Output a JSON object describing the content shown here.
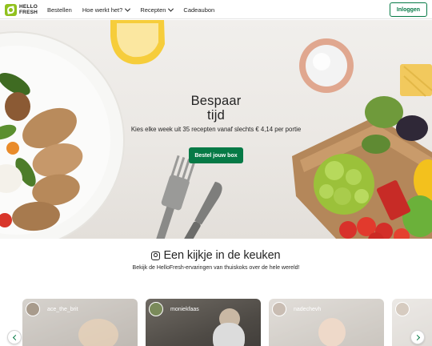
{
  "header": {
    "logo_text": "HELLO FRESH",
    "nav": [
      {
        "label": "Bestellen",
        "has_dropdown": false
      },
      {
        "label": "Hoe werkt het?",
        "has_dropdown": true
      },
      {
        "label": "Recepten",
        "has_dropdown": true
      },
      {
        "label": "Cadeaubon",
        "has_dropdown": false
      }
    ],
    "login_label": "Inloggen"
  },
  "hero": {
    "title_line1": "Bespaar",
    "title_line2": "tijd",
    "subtitle": "Kies elke week uit 35 recepten vanaf slechts € 4,14 per portie",
    "cta_label": "Bestel jouw box"
  },
  "social": {
    "icon": "instagram-icon",
    "heading": "Een kijkje in de keuken",
    "subheading": "Bekijk de HelloFresh-ervaringen van thuiskoks over de hele wereld!",
    "posts": [
      {
        "username": "ace_the_brit"
      },
      {
        "username": "moniekfaas"
      },
      {
        "username": "nadechevh"
      },
      {
        "username": ""
      }
    ]
  },
  "colors": {
    "brand_green": "#067a46",
    "logo_green": "#91c11e",
    "text": "#242424"
  }
}
